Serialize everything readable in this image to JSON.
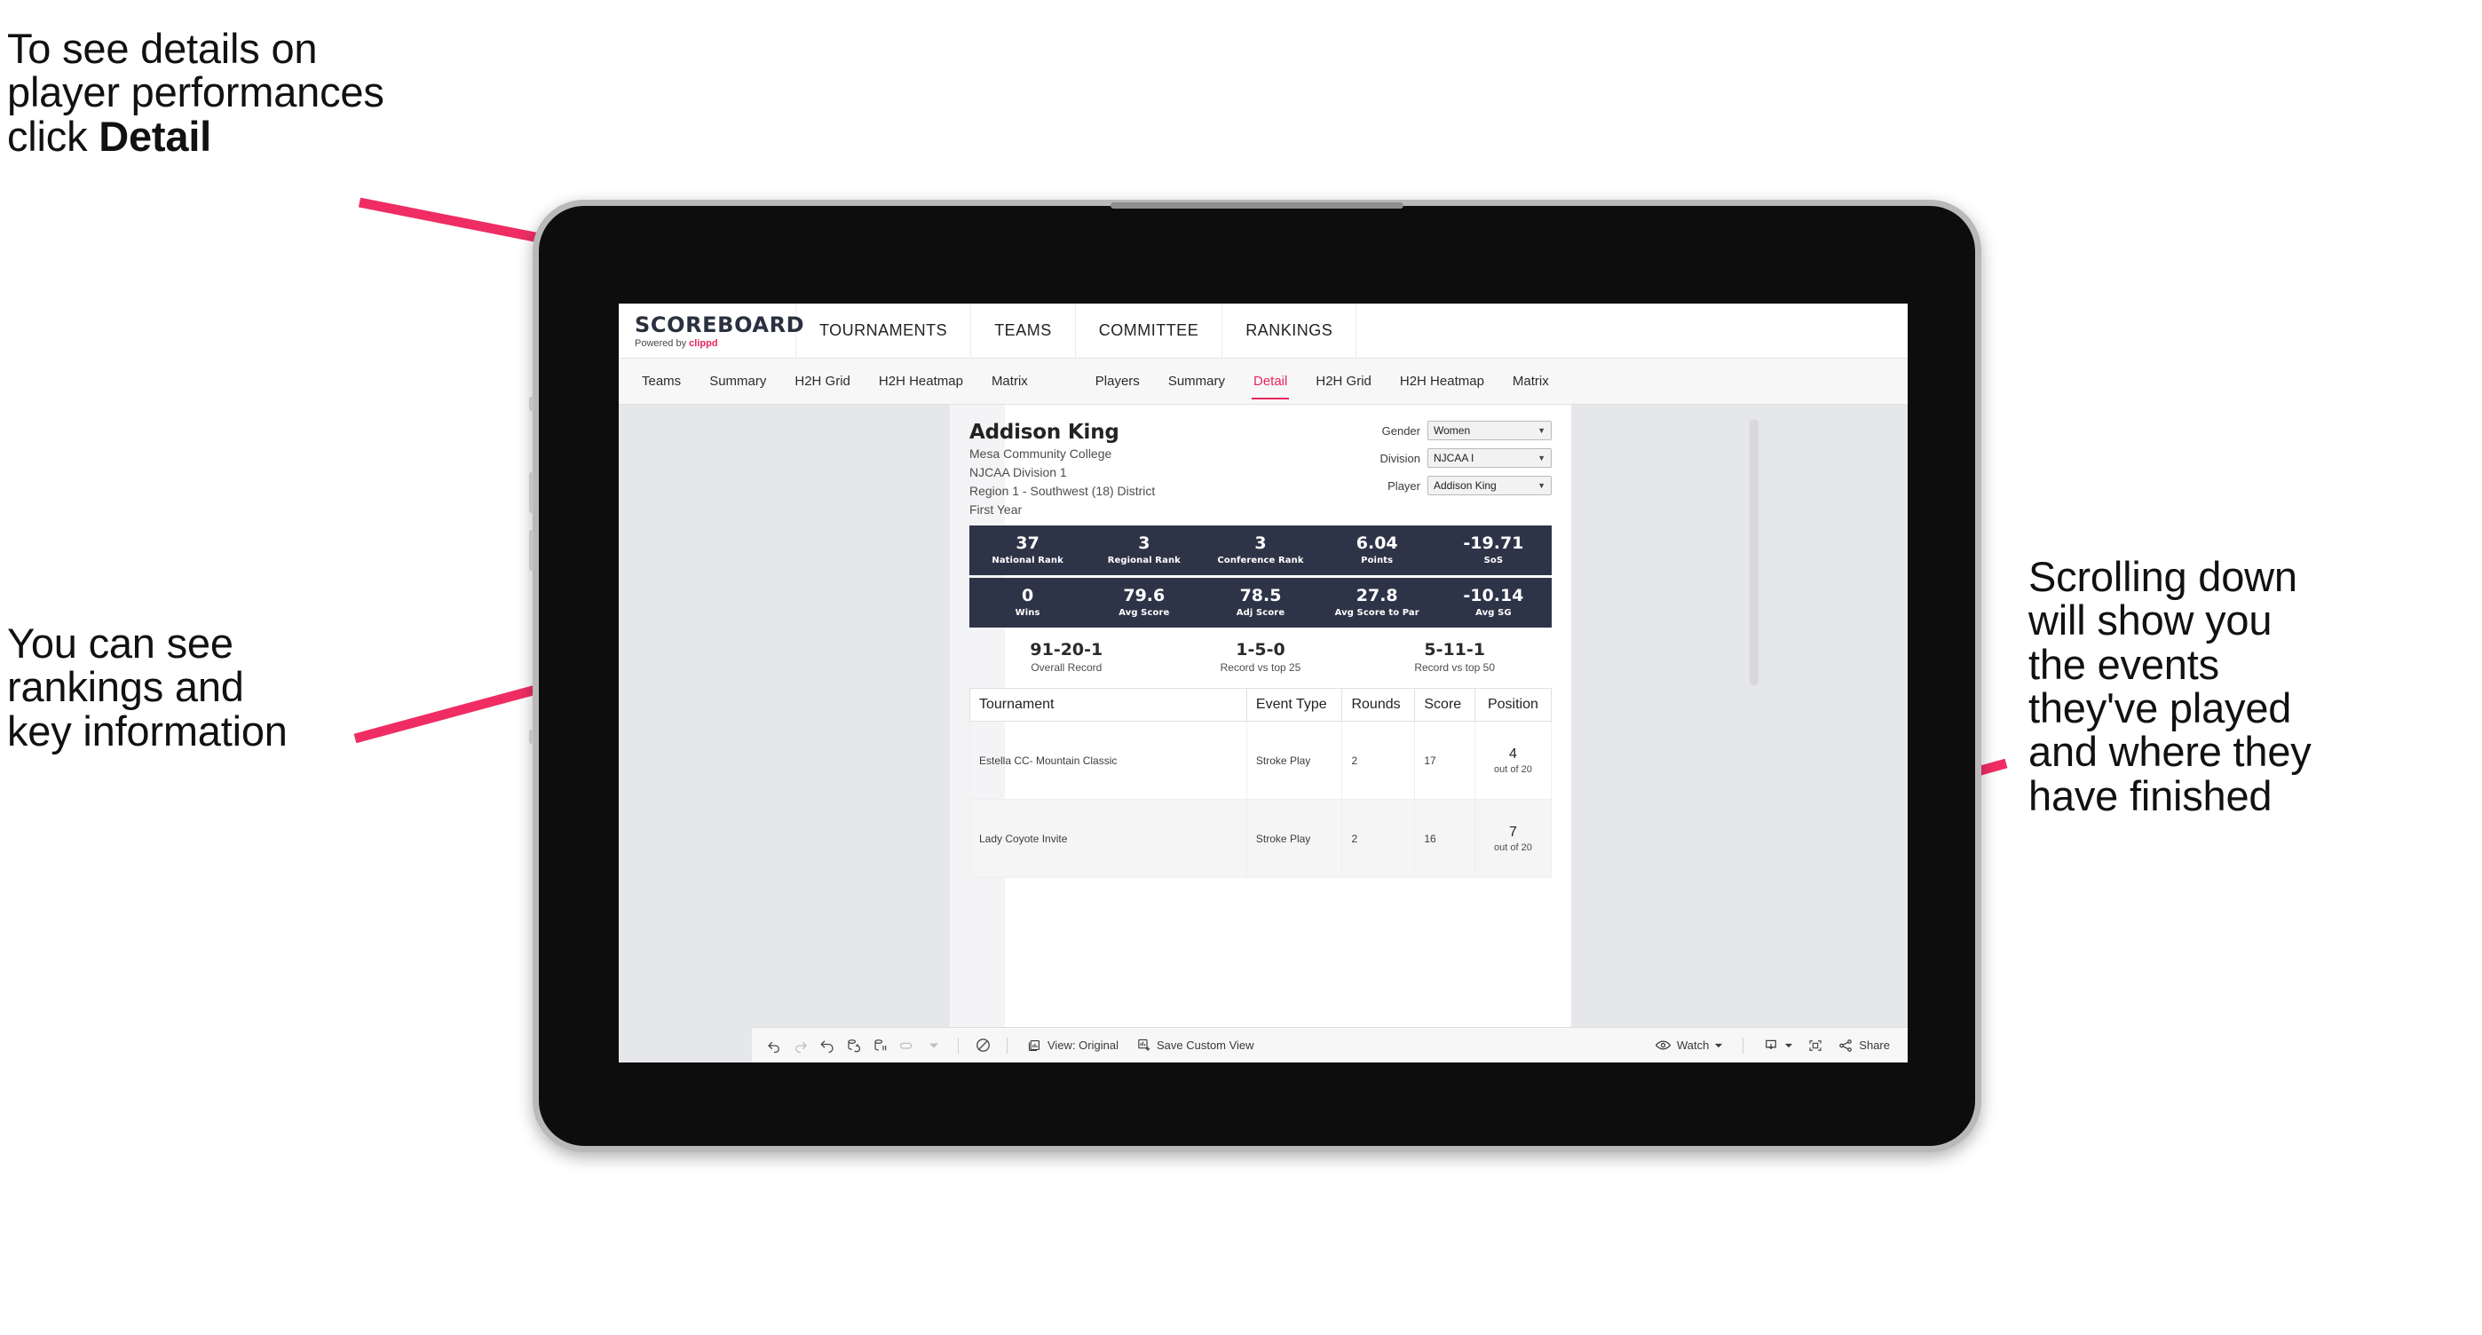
{
  "annotations": {
    "detail_hint": "To see details on\nplayer performances\nclick ",
    "detail_hint_bold": "Detail",
    "rankings_hint": "You can see\nrankings and\nkey information",
    "scroll_hint": "Scrolling down\nwill show you\nthe events\nthey've played\nand where they\nhave finished"
  },
  "colors": {
    "accent_pink": "#e8245c",
    "navy_band": "#2e3448",
    "screen_bg": "#e6e7ea",
    "arrow": "#ef2d63"
  },
  "app": {
    "logo": {
      "title": "SCOREBOARD",
      "powered_prefix": "Powered by ",
      "brand": "clippd"
    },
    "top_nav": [
      "TOURNAMENTS",
      "TEAMS",
      "COMMITTEE",
      "RANKINGS"
    ],
    "sub_nav_teams": [
      "Teams",
      "Summary",
      "H2H Grid",
      "H2H Heatmap",
      "Matrix"
    ],
    "sub_nav_players": [
      "Players",
      "Summary",
      "Detail",
      "H2H Grid",
      "H2H Heatmap",
      "Matrix"
    ],
    "sub_nav_active": "Detail"
  },
  "player": {
    "name": "Addison King",
    "school": "Mesa Community College",
    "division": "NJCAA Division 1",
    "region": "Region 1 - Southwest (18) District",
    "class_year": "First Year"
  },
  "filters": [
    {
      "label": "Gender",
      "value": "Women"
    },
    {
      "label": "Division",
      "value": "NJCAA I"
    },
    {
      "label": "Player",
      "value": "Addison King"
    }
  ],
  "stats_band_1": [
    {
      "value": "37",
      "label": "National Rank"
    },
    {
      "value": "3",
      "label": "Regional Rank"
    },
    {
      "value": "3",
      "label": "Conference Rank"
    },
    {
      "value": "6.04",
      "label": "Points"
    },
    {
      "value": "-19.71",
      "label": "SoS"
    }
  ],
  "stats_band_2": [
    {
      "value": "0",
      "label": "Wins"
    },
    {
      "value": "79.6",
      "label": "Avg Score"
    },
    {
      "value": "78.5",
      "label": "Adj Score"
    },
    {
      "value": "27.8",
      "label": "Avg Score to Par"
    },
    {
      "value": "-10.14",
      "label": "Avg SG"
    }
  ],
  "records": [
    {
      "value": "91-20-1",
      "label": "Overall Record"
    },
    {
      "value": "1-5-0",
      "label": "Record vs top 25"
    },
    {
      "value": "5-11-1",
      "label": "Record vs top 50"
    }
  ],
  "events_table": {
    "headers": [
      "Tournament",
      "Event Type",
      "Rounds",
      "Score",
      "Position"
    ],
    "rows": [
      {
        "tournament": "Estella CC- Mountain Classic",
        "event_type": "Stroke Play",
        "rounds": "2",
        "score": "17",
        "position": "4",
        "position_of": "out of 20"
      },
      {
        "tournament": "Lady Coyote Invite",
        "event_type": "Stroke Play",
        "rounds": "2",
        "score": "16",
        "position": "7",
        "position_of": "out of 20"
      }
    ]
  },
  "toolbar": {
    "view_label": "View: Original",
    "save_label": "Save Custom View",
    "watch_label": "Watch",
    "share_label": "Share"
  }
}
